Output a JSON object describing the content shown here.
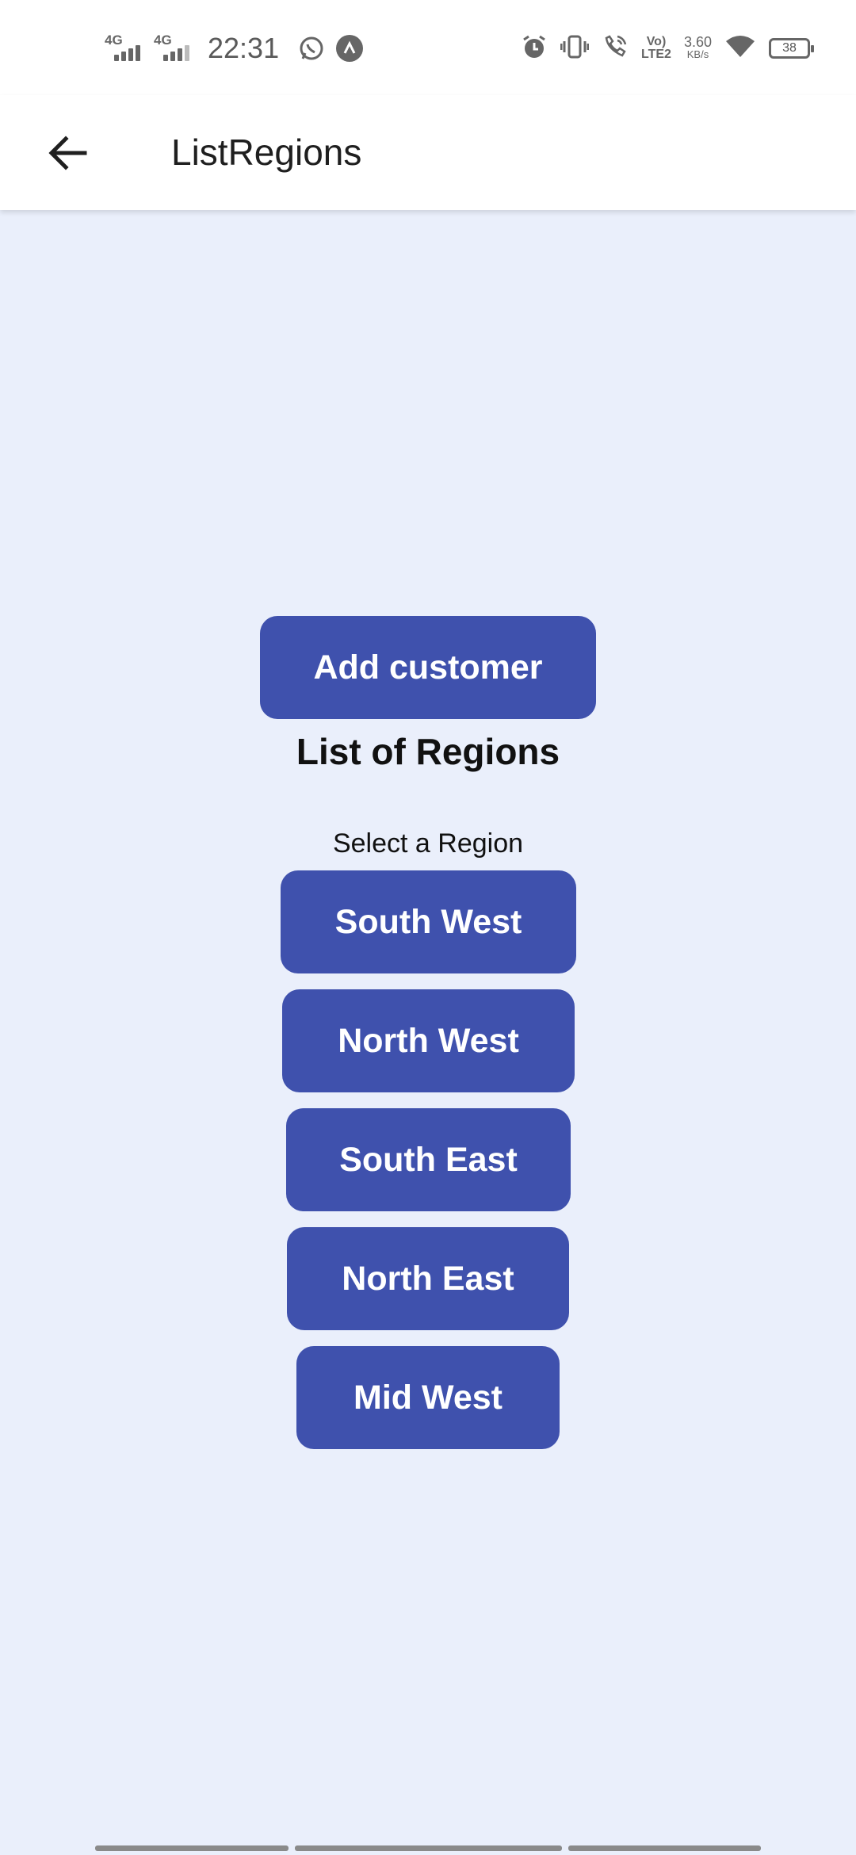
{
  "status_bar": {
    "network1": "4G",
    "network2": "4G",
    "time": "22:31",
    "volte": "Vo)",
    "lte": "LTE2",
    "speed_value": "3.60",
    "speed_unit": "KB/s",
    "battery": "38",
    "icons": [
      "whatsapp-icon",
      "app-notification-icon",
      "alarm-icon",
      "vibrate-icon",
      "wifi-call-icon",
      "wifi-icon",
      "battery-icon"
    ]
  },
  "app_bar": {
    "title": "ListRegions"
  },
  "main": {
    "add_customer_label": "Add customer",
    "heading": "List of Regions",
    "subheading": "Select a Region",
    "regions": [
      {
        "label": "South West"
      },
      {
        "label": "North West"
      },
      {
        "label": "South East"
      },
      {
        "label": "North East"
      },
      {
        "label": "Mid West"
      }
    ]
  },
  "colors": {
    "accent": "#3f51ad",
    "background": "#eaeffb",
    "appbar": "#ffffff"
  }
}
